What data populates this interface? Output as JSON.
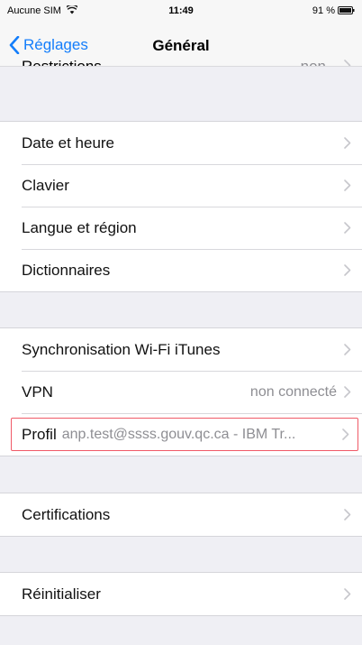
{
  "status_bar": {
    "carrier": "Aucune SIM",
    "wifi_icon": "wifi-icon",
    "time": "11:49",
    "battery": "91 %",
    "battery_icon": "battery-icon"
  },
  "nav": {
    "back_label": "Réglages",
    "back_icon": "chevron-left-icon",
    "title": "Général",
    "accent_color": "#147efb"
  },
  "clipped_row": {
    "label": "Restrictions",
    "value": "non"
  },
  "groups": [
    {
      "items": [
        {
          "label": "Date et heure",
          "value": ""
        },
        {
          "label": "Clavier",
          "value": ""
        },
        {
          "label": "Langue et région",
          "value": ""
        },
        {
          "label": "Dictionnaires",
          "value": ""
        }
      ]
    },
    {
      "items": [
        {
          "label": "Synchronisation Wi-Fi iTunes",
          "value": ""
        },
        {
          "label": "VPN",
          "value": "non connecté"
        }
      ],
      "profile": {
        "label": "Profil",
        "value": "anp.test@ssss.gouv.qc.ca - IBM Tr...",
        "highlight_color": "#f05a67"
      }
    },
    {
      "items": [
        {
          "label": "Certifications",
          "value": ""
        }
      ]
    },
    {
      "items": [
        {
          "label": "Réinitialiser",
          "value": ""
        }
      ]
    }
  ]
}
